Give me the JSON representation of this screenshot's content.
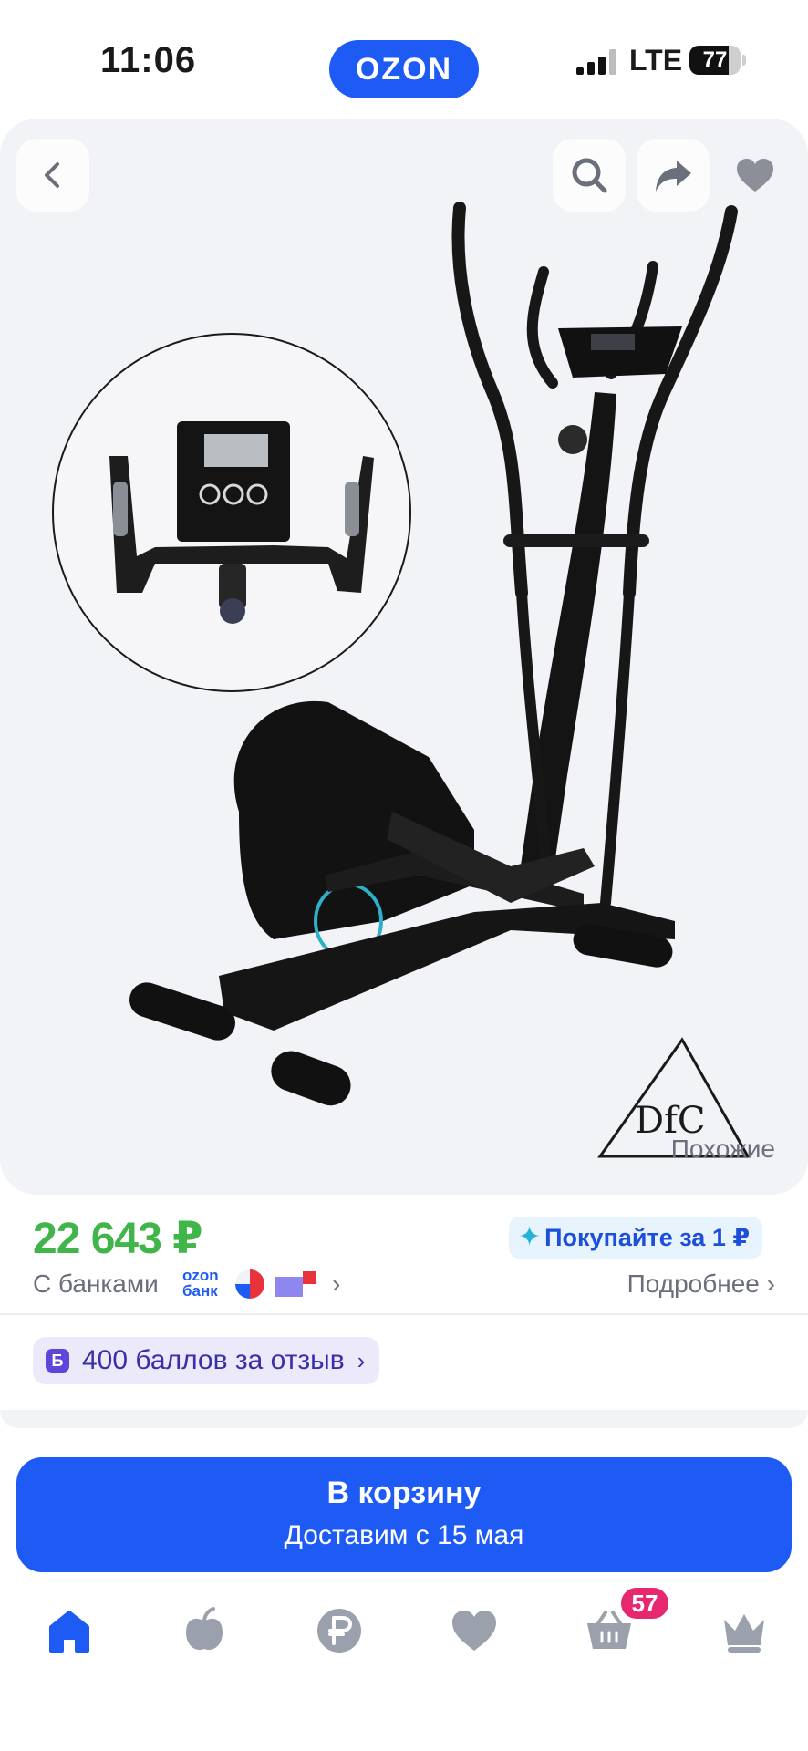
{
  "status_bar": {
    "time": "11:06",
    "network": "LTE",
    "battery": "77",
    "battery_level": 0.77
  },
  "header": {
    "logo": "OZON",
    "brand_color": "#1e5bf5"
  },
  "gallery": {
    "back_icon": "chevron-left-icon",
    "search_icon": "search-icon",
    "share_icon": "share-icon",
    "favorite_icon": "heart-icon",
    "similar_label": "Похожие"
  },
  "price_block": {
    "price": "22 643 ₽",
    "price_color": "#3fb54a",
    "promo": "Покупайте за 1 ₽",
    "banks_label": "С банками",
    "ozon_bank_logo": "ozon банк",
    "details_link": "Подробнее"
  },
  "reward": {
    "icon_letter": "Б",
    "label": "400 баллов за отзыв"
  },
  "cta": {
    "title": "В корзину",
    "subtitle": "Доставим с 15 мая"
  },
  "tab_bar": {
    "items": [
      {
        "icon": "home-icon",
        "active": true
      },
      {
        "icon": "fresh-apple-icon"
      },
      {
        "icon": "ruble-icon"
      },
      {
        "icon": "heart-icon"
      },
      {
        "icon": "cart-icon",
        "badge": "57"
      },
      {
        "icon": "crown-icon"
      }
    ]
  }
}
